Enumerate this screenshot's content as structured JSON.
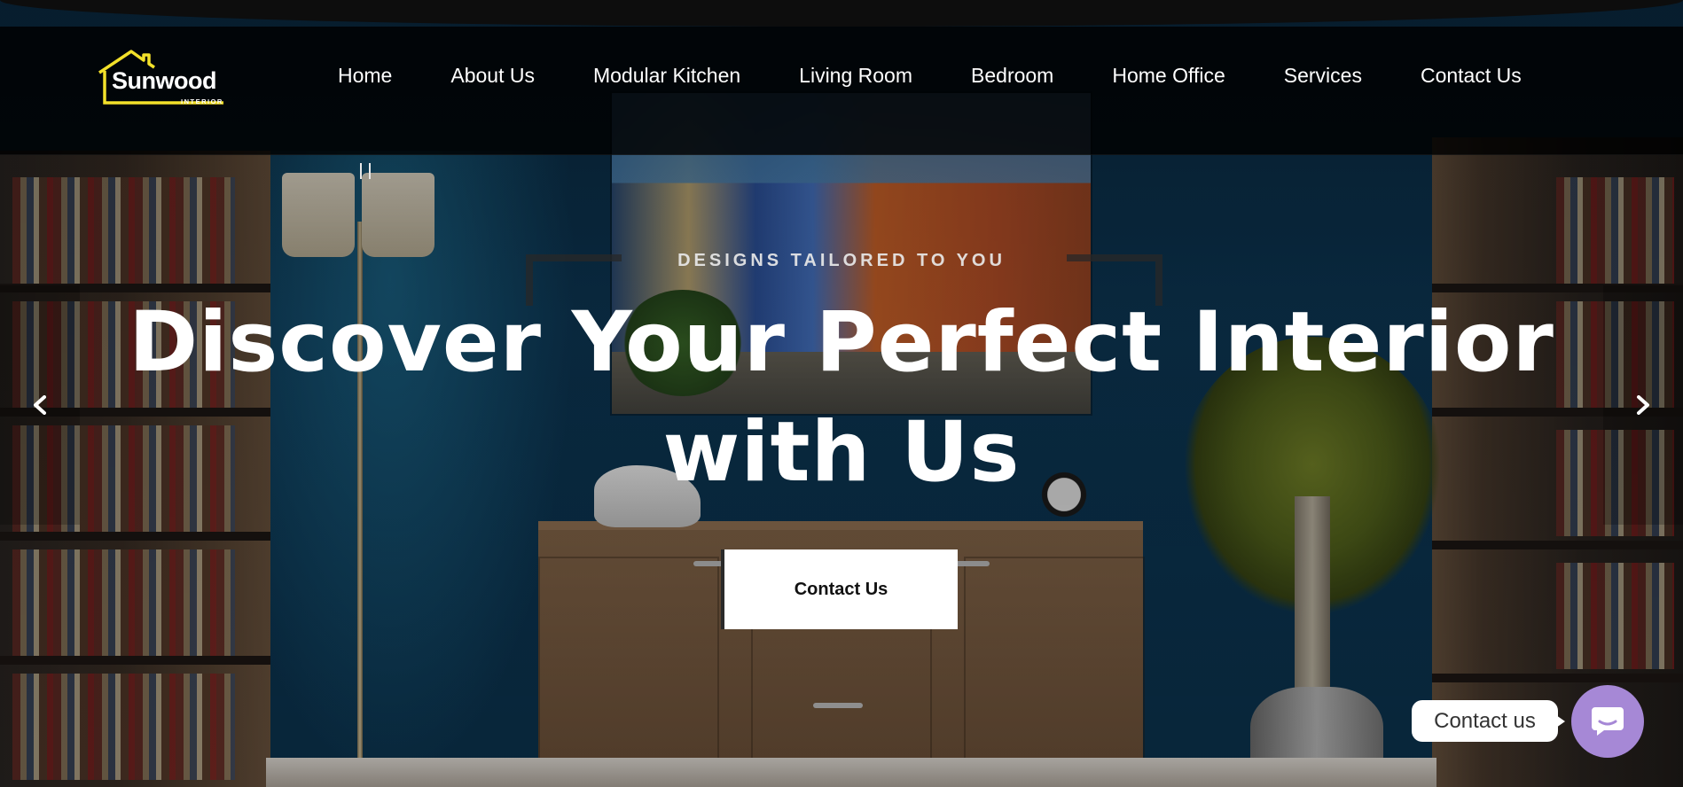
{
  "brand": {
    "name": "Sunwood",
    "sub": "INTERIOR",
    "accent_color": "#f3e12a"
  },
  "nav": {
    "items": [
      {
        "label": "Home"
      },
      {
        "label": "About Us"
      },
      {
        "label": "Modular Kitchen"
      },
      {
        "label": "Living Room"
      },
      {
        "label": "Bedroom"
      },
      {
        "label": "Home Office"
      },
      {
        "label": "Services"
      },
      {
        "label": "Contact Us"
      }
    ]
  },
  "hero": {
    "eyebrow": "DESIGNS TAILORED TO YOU",
    "headline_line1": "Discover Your Perfect Interior",
    "headline_line2": "with Us",
    "cta_label": "Contact Us",
    "prev_icon": "chevron-left-icon",
    "next_icon": "chevron-right-icon"
  },
  "chat": {
    "label": "Contact us",
    "icon": "chat-bubble-icon",
    "color": "#a688d6"
  }
}
